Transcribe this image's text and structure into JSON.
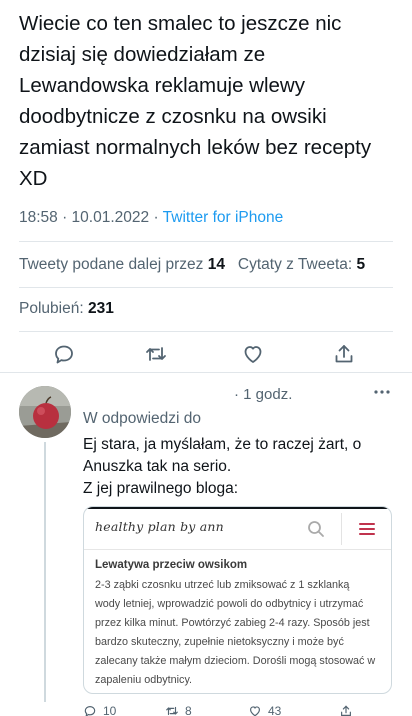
{
  "tweet": {
    "text": "Wiecie co ten smalec to jeszcze nic dzisiaj się dowiedziałam ze Lewandowska reklamuje wlewy doodbytnicze z czosnku na owsiki zamiast normalnych leków bez recepty XD",
    "time": "18:58 · 10.01.2022 · ",
    "source": "Twitter for iPhone"
  },
  "stats": {
    "retweets_label": "Tweety podane dalej przez",
    "retweets_count": "14",
    "quotes_label": "Cytaty z Tweeta:",
    "quotes_count": "5",
    "likes_label": "Polubień:",
    "likes_count": "231"
  },
  "actions": {
    "icons": [
      "reply-icon",
      "retweet-icon",
      "like-icon",
      "share-icon"
    ]
  },
  "reply": {
    "time": "· 1 godz.",
    "in_reply_to": "W odpowiedzi do",
    "line1": "Ej stara, ja myślałam, że to raczej żart, o",
    "line2": "Anuszka tak na serio.",
    "line3": "Z jej prawilnego bloga:",
    "counts": {
      "replies": "10",
      "retweets": "8",
      "likes": "43"
    }
  },
  "card": {
    "logo": "healthy plan by ann",
    "post_title": "Lewatywa przeciw owsikom",
    "post_lines": [
      "2-3 ząbki czosnku utrzeć lub zmiksować z 1 szklanką",
      "wody letniej, wprowadzić powoli do odbytnicy i utrzymać",
      "przez kilka minut. Powtórzyć zabieg 2-4 razy. Sposób jest",
      "bardzo skuteczny, zupełnie nietoksyczny i może być",
      "zalecany także małym dzieciom. Dorośli mogą stosować w",
      "zapaleniu odbytnicy."
    ]
  },
  "colors": {
    "text": "#0f1419",
    "secondary": "#536471",
    "link": "#1d9bf0",
    "blog_accent": "#c0334d"
  }
}
